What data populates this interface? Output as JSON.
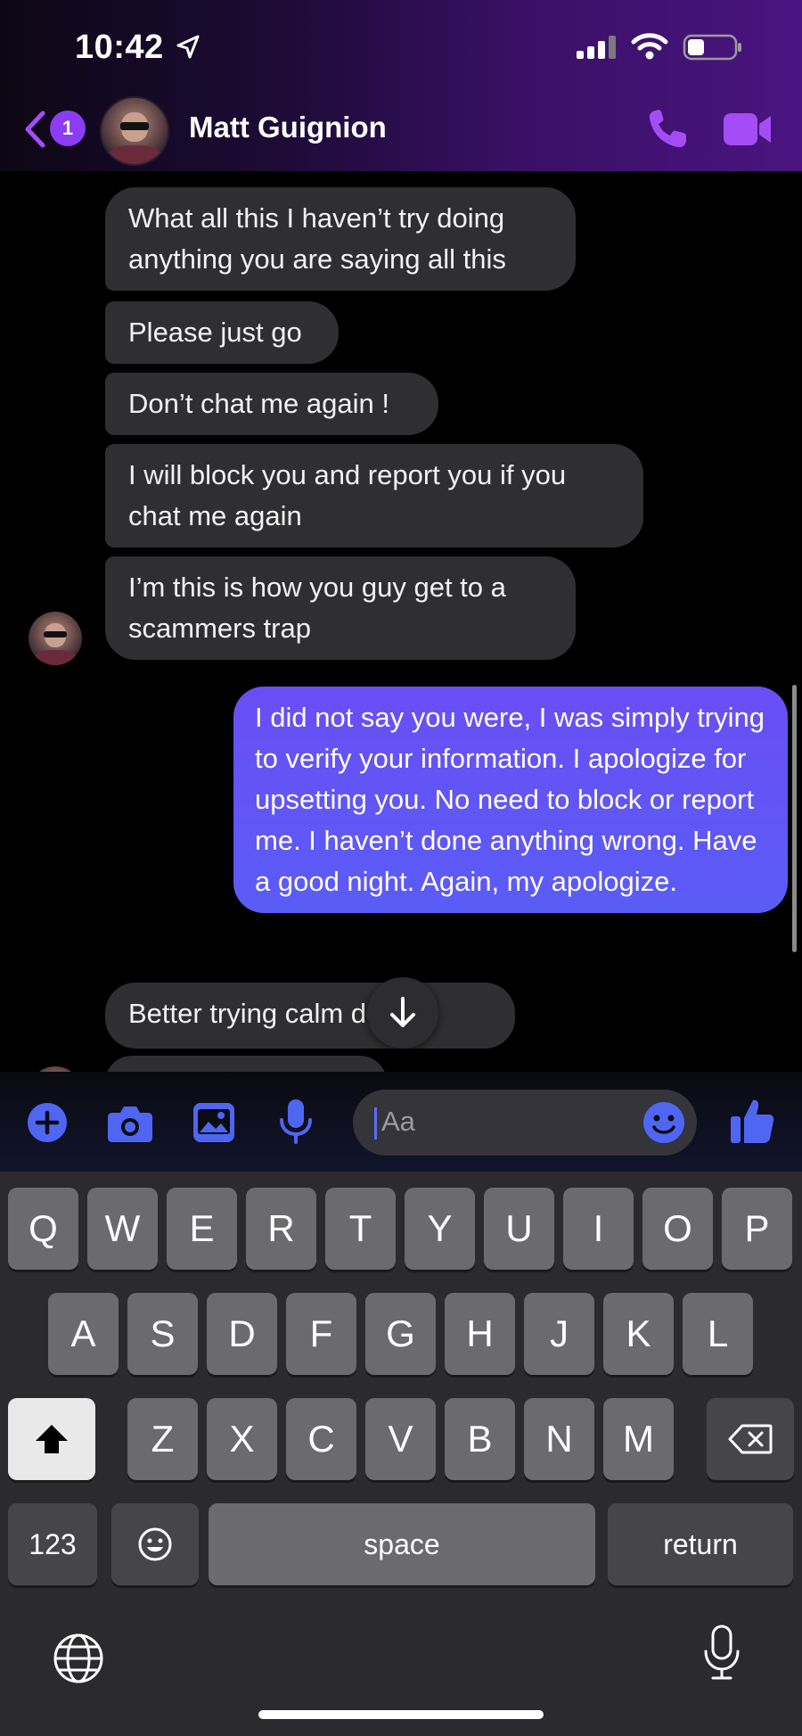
{
  "status_bar": {
    "time": "10:42",
    "icons": [
      "location-arrow-icon",
      "cellular-signal-icon",
      "wifi-icon",
      "battery-icon"
    ]
  },
  "header": {
    "back_icon": "chevron-left-icon",
    "unread_badge": "1",
    "contact_name": "Matt Guignion",
    "actions": [
      "phone-call-icon",
      "video-call-icon"
    ],
    "accent_color": "#a44cf5"
  },
  "messages": [
    {
      "from": "them",
      "text": "What all this I haven’t try doing anything you are saying all this"
    },
    {
      "from": "them",
      "text": "Please just go"
    },
    {
      "from": "them",
      "text": "Don’t chat me again !"
    },
    {
      "from": "them",
      "text": "I will block you and report you if you chat me again"
    },
    {
      "from": "them",
      "text": "I’m this is how you guy get to a scammers trap"
    },
    {
      "from": "me",
      "text": "I did not say you were, I was simply trying to verify your information. I apologize for upsetting you. No need to block or report me. I haven’t done anything wrong. Have a good night. Again, my apologize."
    },
    {
      "from": "them",
      "text": "Better trying calm down"
    }
  ],
  "composer": {
    "icons": [
      "add-icon",
      "camera-icon",
      "gallery-icon",
      "microphone-icon",
      "emoji-icon",
      "thumbs-up-icon"
    ],
    "placeholder": "Aa",
    "icon_color": "#4f66f2"
  },
  "keyboard": {
    "row1": [
      "Q",
      "W",
      "E",
      "R",
      "T",
      "Y",
      "U",
      "I",
      "O",
      "P"
    ],
    "row2": [
      "A",
      "S",
      "D",
      "F",
      "G",
      "H",
      "J",
      "K",
      "L"
    ],
    "row3": [
      "Z",
      "X",
      "C",
      "V",
      "B",
      "N",
      "M"
    ],
    "numbers_key": "123",
    "space_key": "space",
    "return_key": "return",
    "icons": [
      "shift-icon",
      "backspace-icon",
      "emoji-keyboard-icon",
      "globe-icon",
      "dictation-mic-icon"
    ]
  },
  "colors": {
    "sent_bubble": "#5a5cf6",
    "received_bubble": "#2f2f31",
    "background": "#000000"
  }
}
